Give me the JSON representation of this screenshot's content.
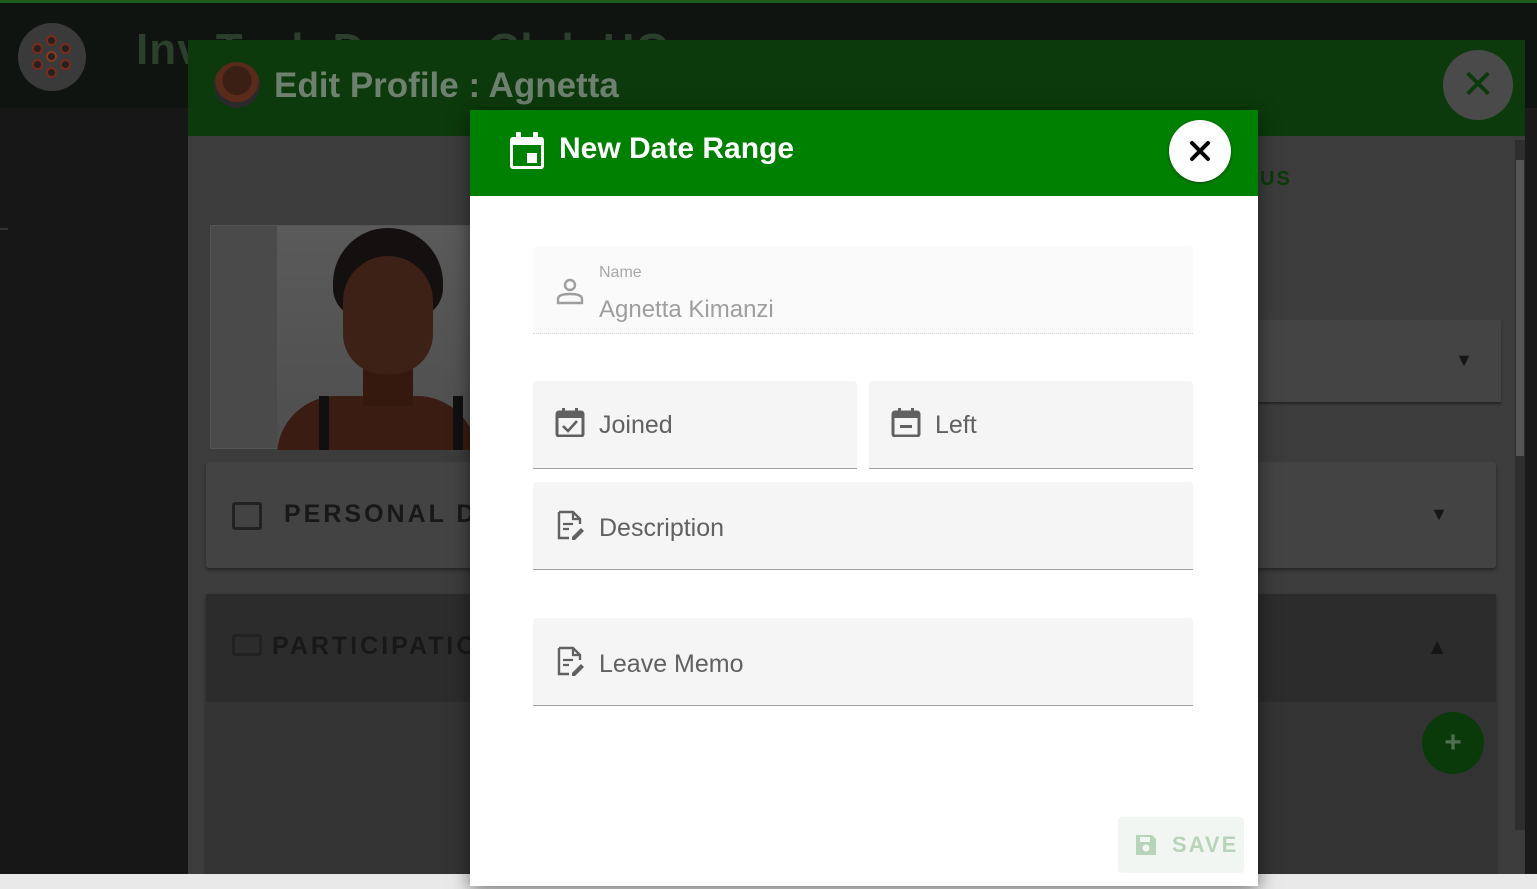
{
  "app": {
    "title": "Inv Tech Drama Club HQ",
    "logo_icon": "flower-logo-icon"
  },
  "edit_profile": {
    "title": "Edit Profile : Agnetta",
    "close_icon": "close-icon",
    "status_fragment": "US",
    "sections": {
      "personal_label": "PERSONAL DE",
      "participation_label": "PARTICIPATIO"
    },
    "add_icon": "plus-icon"
  },
  "modal": {
    "title": "New Date Range",
    "header_icon": "calendar-icon",
    "close_icon": "close-icon",
    "fields": {
      "name": {
        "label": "Name",
        "value": "Agnetta Kimanzi",
        "icon": "person-icon"
      },
      "joined": {
        "label": "Joined",
        "icon": "calendar-check-icon"
      },
      "left": {
        "label": "Left",
        "icon": "calendar-minus-icon"
      },
      "description": {
        "label": "Description",
        "icon": "file-edit-icon"
      },
      "leave_memo": {
        "label": "Leave Memo",
        "icon": "file-edit-icon"
      }
    },
    "save": {
      "label": "SAVE",
      "icon": "save-icon",
      "disabled": true
    }
  },
  "colors": {
    "header_green": "#008000",
    "save_disabled_text": "#b8d4b8"
  }
}
